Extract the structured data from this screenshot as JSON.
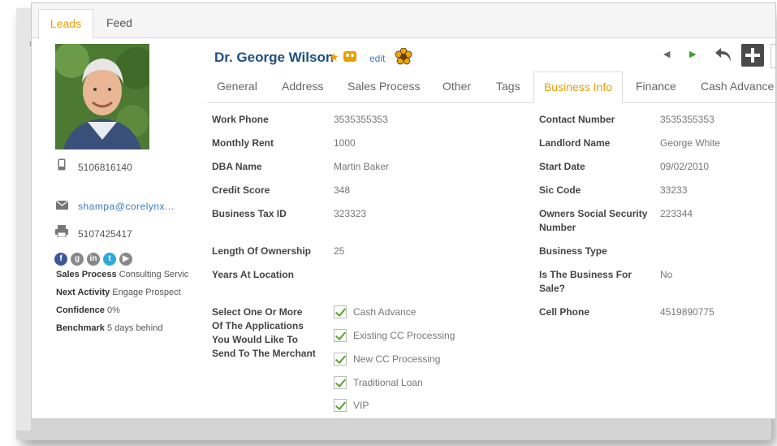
{
  "top_tabs": [
    {
      "label": "Leads",
      "active": true
    },
    {
      "label": "Feed",
      "active": false
    }
  ],
  "profile": {
    "name": "Dr. George Wilson",
    "edit_label": "edit",
    "phone": "5106816140",
    "email": "shampa@corelynx...",
    "fax": "5107425417",
    "sales_process_label": "Sales Process",
    "sales_process_value": "Consulting Servic",
    "next_activity_label": "Next Activity",
    "next_activity_value": "Engage Prospect",
    "confidence_label": "Confidence",
    "confidence_value": "0%",
    "benchmark_label": "Benchmark",
    "benchmark_value": "5 days behind"
  },
  "section_tabs": [
    {
      "label": "General"
    },
    {
      "label": "Address"
    },
    {
      "label": "Sales Process"
    },
    {
      "label": "Other"
    },
    {
      "label": "Tags"
    },
    {
      "label": "Business Info",
      "active": true
    },
    {
      "label": "Finance"
    },
    {
      "label": "Cash Advance"
    }
  ],
  "left_fields": [
    {
      "label": "Work Phone",
      "value": "3535355353"
    },
    {
      "label": "Monthly Rent",
      "value": "1000"
    },
    {
      "label": "DBA Name",
      "value": "Martin Baker"
    },
    {
      "label": "Credit Score",
      "value": "348"
    },
    {
      "label": "Business Tax ID",
      "value": "323323"
    },
    {
      "label": "Length Of Ownership",
      "value": "25"
    },
    {
      "label": "Years At Location",
      "value": ""
    },
    {
      "label": "Select One Or More Of The Applications You Would Like To Send To The Merchant",
      "value": ""
    }
  ],
  "applications": [
    "Cash Advance",
    "Existing CC Processing",
    "New CC Processing",
    "Traditional Loan",
    "VIP"
  ],
  "right_fields": [
    {
      "label": "Contact Number",
      "value": "3535355353"
    },
    {
      "label": "Landlord Name",
      "value": "George White"
    },
    {
      "label": "Start Date",
      "value": "09/02/2010"
    },
    {
      "label": "Sic Code",
      "value": "33233"
    },
    {
      "label": "Owners Social Security Number",
      "value": "223344"
    },
    {
      "label": "Business Type",
      "value": ""
    },
    {
      "label": "Is The Business For Sale?",
      "value": "No"
    },
    {
      "label": "Cell Phone",
      "value": "4519890775"
    }
  ],
  "colors": {
    "accent": "#e8a000",
    "name": "#1e4f84",
    "link": "#3a7cc7",
    "check": "#5aa02c"
  },
  "icons": [
    "star-icon",
    "owl-icon",
    "flower-icon",
    "prev-arrow-icon",
    "next-arrow-icon",
    "undo-icon",
    "add-icon",
    "phone-icon",
    "email-icon",
    "printer-icon",
    "facebook-icon",
    "google-icon",
    "linkedin-icon",
    "twitter-icon",
    "youtube-icon"
  ]
}
